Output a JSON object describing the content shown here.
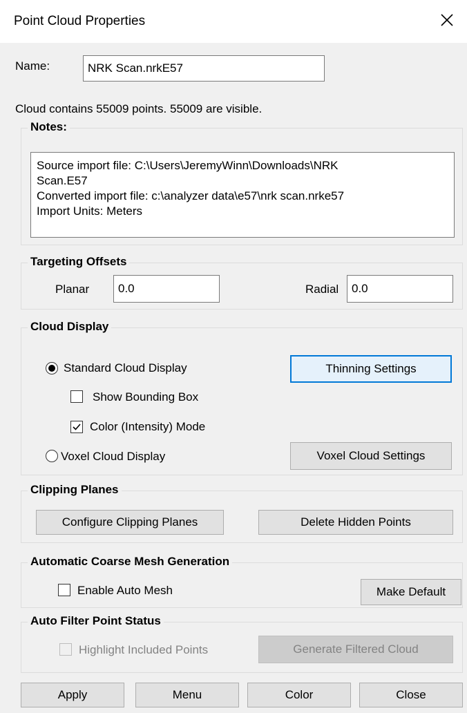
{
  "window": {
    "title": "Point Cloud Properties",
    "close_icon": "close-icon"
  },
  "name_row": {
    "label": "Name:",
    "value": "NRK Scan.nrkE57"
  },
  "cloud_info": "Cloud contains 55009 points.  55009 are visible.",
  "notes": {
    "legend": "Notes:",
    "text": "Source import file: C:\\Users\\JeremyWinn\\Downloads\\NRK\nScan.E57\nConverted import file: c:\\analyzer data\\e57\\nrk scan.nrke57\nImport Units: Meters"
  },
  "targeting": {
    "legend": "Targeting Offsets",
    "planar_label": "Planar",
    "planar_value": "0.0",
    "radial_label": "Radial",
    "radial_value": "0.0"
  },
  "cloud_display": {
    "legend": "Cloud Display",
    "standard_label": "Standard Cloud Display",
    "standard_selected": true,
    "thinning_button": "Thinning Settings",
    "bounding_box_label": "Show Bounding Box",
    "bounding_box_checked": false,
    "color_mode_label": "Color (Intensity) Mode",
    "color_mode_checked": true,
    "voxel_label": "Voxel Cloud Display",
    "voxel_selected": false,
    "voxel_button": "Voxel Cloud Settings"
  },
  "clipping": {
    "legend": "Clipping Planes",
    "configure_button": "Configure Clipping Planes",
    "delete_button": "Delete Hidden Points"
  },
  "auto_mesh": {
    "legend": "Automatic Coarse Mesh Generation",
    "enable_label": "Enable Auto Mesh",
    "enable_checked": false,
    "make_default_button": "Make Default"
  },
  "auto_filter": {
    "legend": "Auto Filter Point Status",
    "highlight_label": "Highlight Included Points",
    "highlight_checked": false,
    "generate_button": "Generate Filtered Cloud"
  },
  "bottom_buttons": {
    "apply": "Apply",
    "menu": "Menu",
    "color": "Color",
    "close": "Close"
  }
}
